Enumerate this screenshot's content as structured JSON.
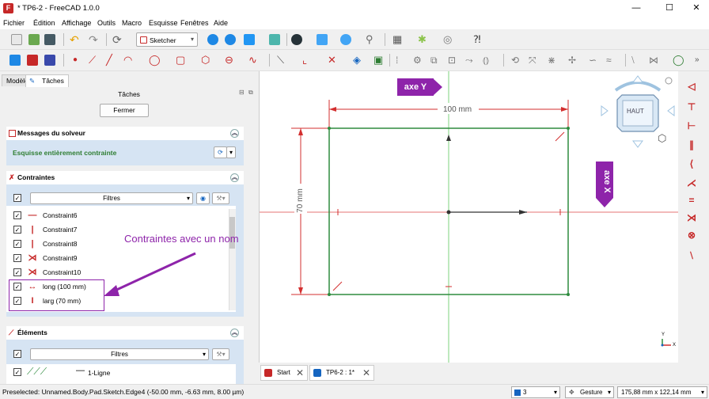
{
  "window": {
    "title": "* TP6-2 - FreeCAD 1.0.0",
    "minimize": "—",
    "maximize": "☐",
    "close": "✕"
  },
  "menu": [
    "Fichier",
    "Édition",
    "Affichage",
    "Outils",
    "Macro",
    "Esquisse",
    "Fenêtres",
    "Aide"
  ],
  "toolbar": {
    "workbench": "Sketcher"
  },
  "panel": {
    "tabs": [
      "Modèle",
      "Tâches"
    ],
    "header": "Tâches",
    "close_button": "Fermer",
    "solver_section": "Messages du solveur",
    "solver_message": "Esquisse entièrement contrainte",
    "constraints_section": "Contraintes",
    "filters": "Filtres",
    "constraints": [
      {
        "label": "Constraint6",
        "symbol": "—"
      },
      {
        "label": "Constraint7",
        "symbol": "|"
      },
      {
        "label": "Constraint8",
        "symbol": "|"
      },
      {
        "label": "Constraint9",
        "symbol": "⋊"
      },
      {
        "label": "Constraint10",
        "symbol": "⋊"
      },
      {
        "label": "long (100 mm)",
        "symbol": "↔"
      },
      {
        "label": "larg (70 mm)",
        "symbol": "I"
      }
    ],
    "elements_section": "Éléments",
    "element_first": "1-Ligne"
  },
  "annotations": {
    "named_constraints": "Contraintes avec un nom",
    "axis_y": "axe Y",
    "axis_x": "axe X"
  },
  "viewport": {
    "dim_width": "100 mm",
    "dim_height": "70 mm",
    "navcube_face": "HAUT",
    "axis_y_label": "Y",
    "axis_x_label": "X"
  },
  "doc_tabs": [
    "Start",
    "TP6-2 : 1*"
  ],
  "status": {
    "message": "Preselected: Unnamed.Body.Pad.Sketch.Edge4 (-50.00 mm, -6.63 mm, 8.00 µm)",
    "layer": "3",
    "nav_style": "Gesture",
    "dimensions": "175,88 mm x 122,14 mm"
  },
  "colors": {
    "accent_purple": "#8e24aa",
    "sketch_green": "#2e8b3e",
    "sketch_red": "#d32f2f",
    "solver_green": "#2e7d32"
  }
}
